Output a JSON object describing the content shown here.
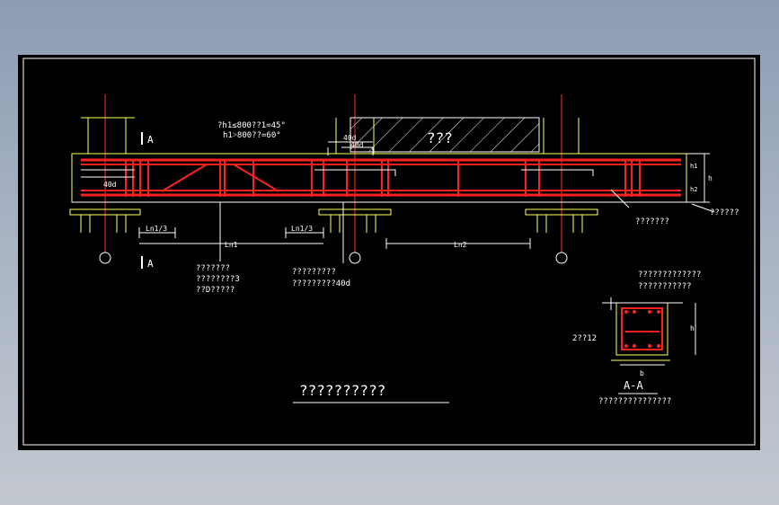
{
  "labels": {
    "angle_note_1": "?h1≤800??1=45°",
    "angle_note_2": "h1˃800??=60°",
    "hatch_label": "???",
    "forty_d_a": "40d",
    "forty_d_b": "40d",
    "forty_d_left": "40d",
    "section_mark_top": "A",
    "section_mark_bottom": "A",
    "dim_ln1_left": "Ln1/3",
    "dim_ln1_right": "Ln1/3",
    "dim_ln1": "Ln1",
    "dim_ln2": "Ln2",
    "dim_h": "h",
    "dim_h1": "h1",
    "dim_h2": "h2",
    "note_a_1": "???????",
    "note_a_2": "????????3",
    "note_a_3": "??D?????",
    "note_b_1": "?????????",
    "note_b_2": "?????????40d",
    "note_c": "???????",
    "note_d": "??????",
    "sec_note_1": "?????????????",
    "sec_note_2": "???????????",
    "sec_stirrup": "2??12",
    "sec_dim_b": "b",
    "sec_dim_h": "h",
    "sec_title": "A-A",
    "sec_caption": "???????????????",
    "main_title": "??????????"
  },
  "colors": {
    "background": "#000000",
    "rebar": "#ff2020",
    "outline": "#ffffff",
    "concrete": "#ffff66",
    "axis": "#ff3030",
    "accent": "#ffff00"
  }
}
